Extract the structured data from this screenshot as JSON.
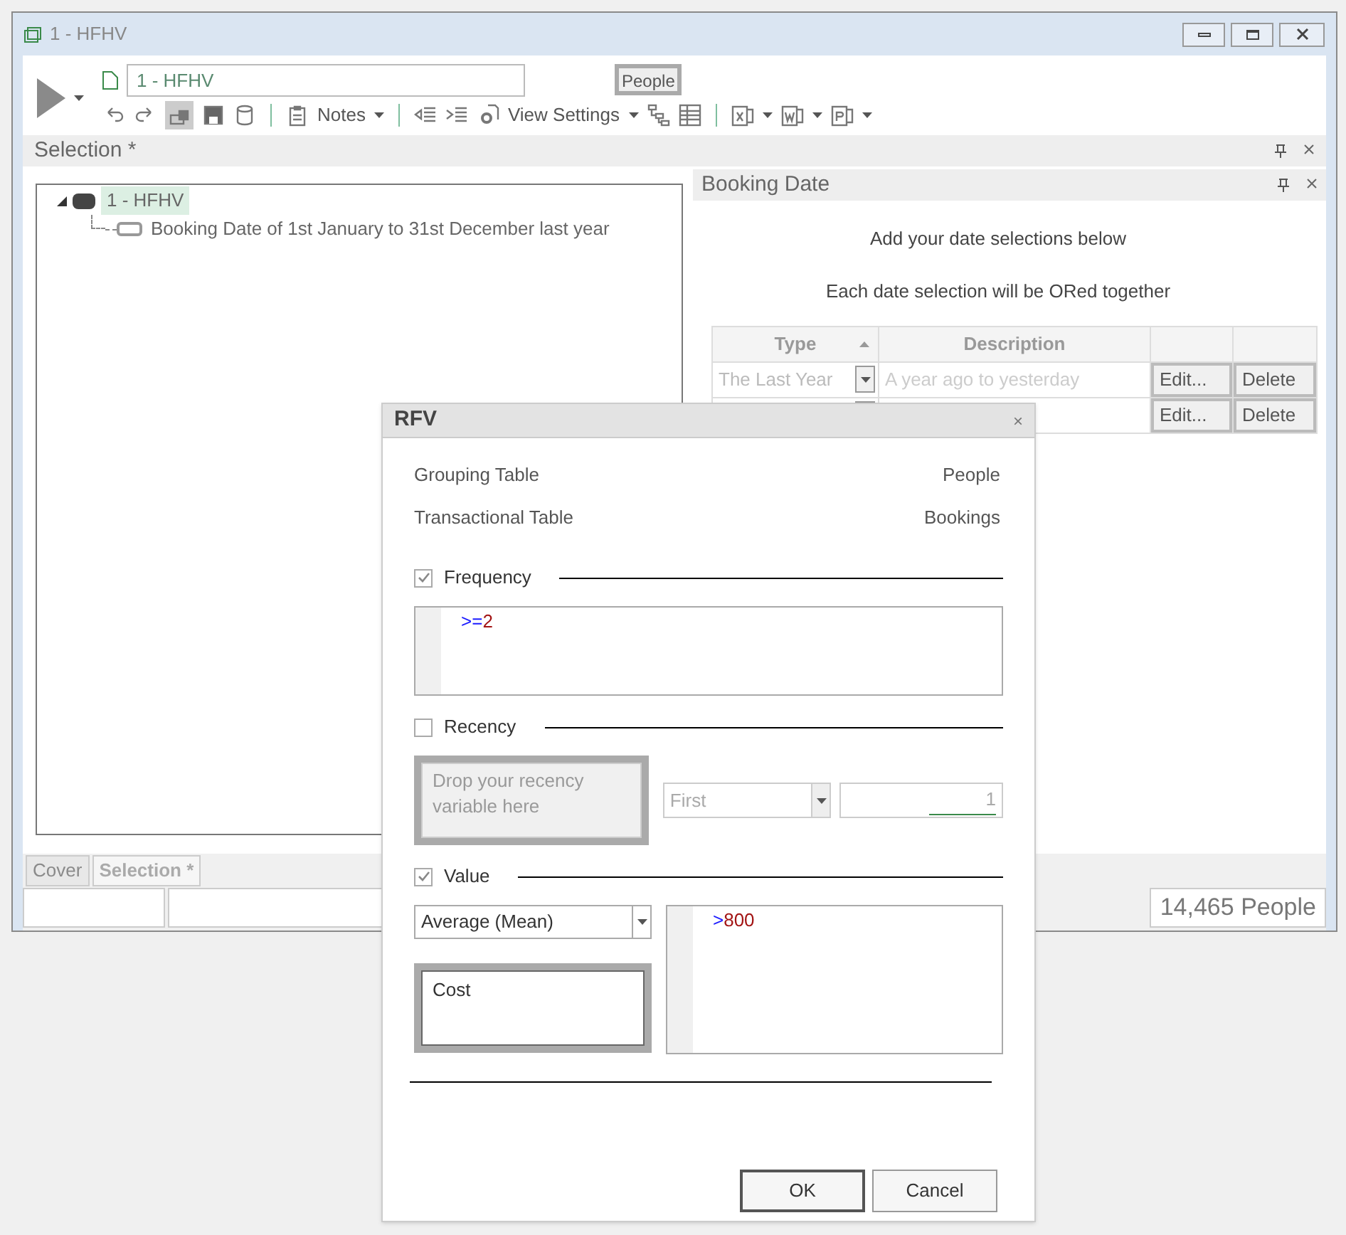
{
  "window": {
    "title": "1 - HFHV"
  },
  "toolbar": {
    "name_value": "1 - HFHV",
    "table_button": "People",
    "notes": "Notes",
    "view_settings": "View Settings"
  },
  "selection_panel": {
    "title": "Selection *",
    "tree": [
      {
        "label": "1 - HFHV",
        "selected": true,
        "expanded": true,
        "children": [
          {
            "label": "Booking Date of 1st January to 31st December last year",
            "selected": false
          }
        ]
      }
    ]
  },
  "booking_panel": {
    "title": "Booking Date",
    "hint": "Add your date selections below",
    "note": "Each date selection will be ORed together",
    "columns": [
      "Type",
      "Description"
    ],
    "rows": [
      {
        "type": "The Last Year",
        "description": "A year ago to yesterday",
        "edit": "Edit...",
        "delete": "Delete"
      },
      {
        "edit": "Edit...",
        "delete": "Delete"
      }
    ]
  },
  "bottom_tabs": [
    {
      "label": "Cover",
      "selected": false
    },
    {
      "label": "Selection *",
      "selected": true
    }
  ],
  "status_bar": {
    "count": "14,465 People"
  },
  "dialog": {
    "title": "RFV",
    "close": "×",
    "info": [
      {
        "label": "Grouping Table",
        "value": "People"
      },
      {
        "label": "Transactional Table",
        "value": "Bookings"
      }
    ],
    "frequency": {
      "label": "Frequency",
      "checked": true,
      "expression": [
        {
          "text": ">=",
          "kind": "operator"
        },
        {
          "text": "2",
          "kind": "number"
        }
      ]
    },
    "recency": {
      "label": "Recency",
      "checked": false,
      "drop_placeholder": "Drop your recency variable here",
      "order": "First",
      "count": "1"
    },
    "value": {
      "label": "Value",
      "checked": true,
      "aggregate": "Average (Mean)",
      "variable": "Cost",
      "expression": [
        {
          "text": ">",
          "kind": "operator"
        },
        {
          "text": "800",
          "kind": "number"
        }
      ]
    },
    "buttons": [
      "OK",
      "Cancel"
    ]
  }
}
